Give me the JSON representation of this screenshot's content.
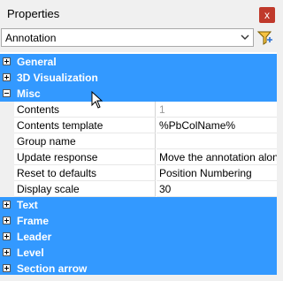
{
  "window": {
    "title": "Properties",
    "close_glyph": "x"
  },
  "selector": {
    "value": "Annotation"
  },
  "categories_top": [
    {
      "label": "General",
      "state": "collapsed"
    },
    {
      "label": "3D Visualization",
      "state": "collapsed"
    },
    {
      "label": "Misc",
      "state": "expanded"
    }
  ],
  "misc_props": [
    {
      "name": "Contents",
      "value": "1",
      "disabled": true
    },
    {
      "name": "Contents template",
      "value": "%PbColName%"
    },
    {
      "name": "Group name",
      "value": ""
    },
    {
      "name": "Update response",
      "value": "Move the annotation along"
    },
    {
      "name": "Reset to defaults",
      "value": "Position Numbering"
    },
    {
      "name": "Display scale",
      "value": "30"
    }
  ],
  "categories_bottom": [
    {
      "label": "Text",
      "state": "collapsed"
    },
    {
      "label": "Frame",
      "state": "collapsed"
    },
    {
      "label": "Leader",
      "state": "collapsed"
    },
    {
      "label": "Level",
      "state": "collapsed"
    },
    {
      "label": "Section arrow",
      "state": "collapsed"
    }
  ],
  "colors": {
    "category_bg": "#3399ff",
    "close_bg": "#c0392b"
  },
  "icons": {
    "close": "close-icon",
    "filter": "quick-select-filter-icon",
    "expand": "plus-box-icon",
    "collapse": "minus-box-icon"
  }
}
